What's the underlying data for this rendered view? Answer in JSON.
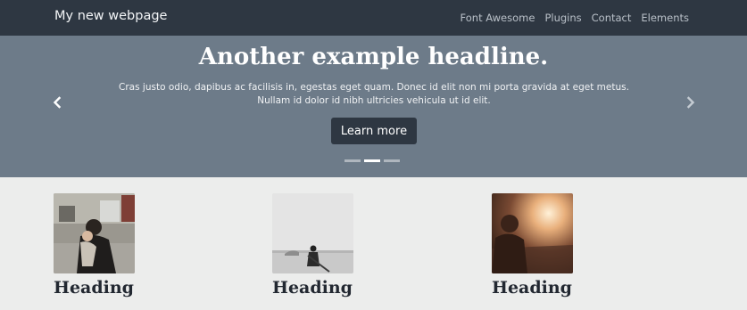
{
  "navbar": {
    "brand": "My new webpage",
    "links": [
      "Font Awesome",
      "Plugins",
      "Contact",
      "Elements"
    ]
  },
  "carousel": {
    "headline": "Another example headline.",
    "text": "Cras justo odio, dapibus ac facilisis in, egestas eget quam. Donec id elit non mi porta gravida at eget metus. Nullam id dolor id nibh ultricies vehicula ut id elit.",
    "button": "Learn more",
    "prev_icon": "chevron-left-icon",
    "next_icon": "chevron-right-icon",
    "indicator_count": 3,
    "active_indicator": 2
  },
  "cards": [
    {
      "heading": "Heading",
      "image": "mother-and-child-photo"
    },
    {
      "heading": "Heading",
      "image": "person-on-beach-photo"
    },
    {
      "heading": "Heading",
      "image": "woman-at-sunset-photo"
    }
  ],
  "colors": {
    "navbar_bg": "#2e3742",
    "carousel_bg": "#6d7b89",
    "page_bg": "#ecedec"
  }
}
